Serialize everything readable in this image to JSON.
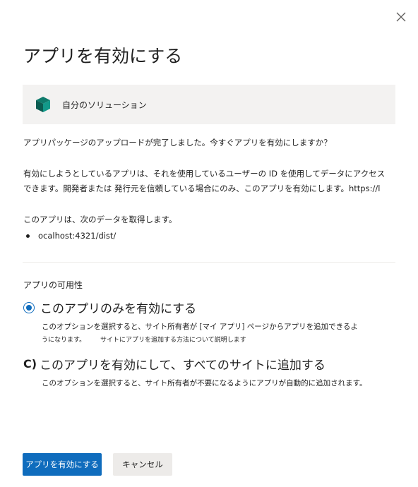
{
  "dialog": {
    "title": "アプリを有効にする",
    "close_icon": "close-icon"
  },
  "solution": {
    "icon": "solution-cube-icon",
    "name": "自分のソリューション",
    "icon_color": "#0f7b6c"
  },
  "body": {
    "para1": "アプリパッケージのアップロードが完了しました。今すぐアプリを有効にしますか？",
    "para2": "有効にしようとしているアプリは、それを使用しているユーザーの ID を使用してデータにアクセスできます。開発者または 発行元を信頼している場合にのみ、このアプリを有効にします。https://l",
    "para3": "このアプリは、次のデータを取得します。",
    "data_items": [
      "ocalhost:4321/dist/"
    ]
  },
  "availability": {
    "label": "アプリの可用性",
    "options": [
      {
        "label": "このアプリのみを有効にする",
        "selected": true,
        "desc_line1": "このオプションを選択すると、サイト所有者が [マイ アプリ] ページからアプリを追加できるよ",
        "desc_line2a": "うになります。",
        "desc_line2b": "サイトにアプリを追加する方法について説明します"
      },
      {
        "label": "このアプリを有効にして、すべてのサイトに追加する",
        "selected": false,
        "radio_glyph": "C)",
        "desc_line1": "このオプションを選択すると、サイト所有者が不要になるようにアプリが自動的に追加されます。"
      }
    ]
  },
  "buttons": {
    "enable": "アプリを有効にする",
    "cancel": "キャンセル"
  },
  "colors": {
    "accent": "#0f6cbd",
    "panel": "#f3f2f1"
  }
}
